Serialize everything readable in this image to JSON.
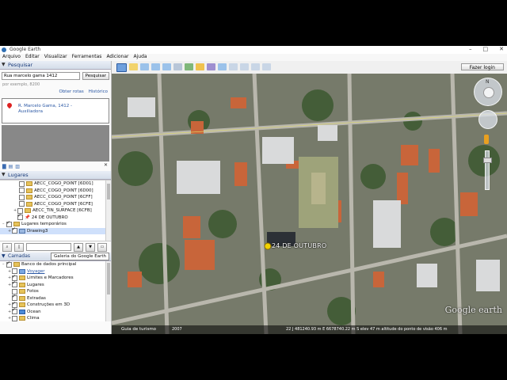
{
  "window": {
    "title": "Google Earth",
    "controls": [
      "–",
      "□",
      "✕"
    ]
  },
  "menu": [
    "Arquivo",
    "Editar",
    "Visualizar",
    "Ferramentas",
    "Adicionar",
    "Ajuda"
  ],
  "search": {
    "header": "Pesquisar",
    "value": "Rua marcelo gama 1412",
    "button": "Pesquisar",
    "hint": "por exemplo, 8200",
    "link_routes": "Obter rotas",
    "link_history": "Histórico",
    "result_line1": "R. Marcelo Gama, 1412 -",
    "result_line2": "Auxiliadora"
  },
  "places": {
    "header": "Lugares",
    "items": [
      {
        "label": "AECC_COGO_POINT [6D01]",
        "checked": false
      },
      {
        "label": "AECC_COGO_POINT [6D00]",
        "checked": false
      },
      {
        "label": "AECC_COGO_POINT [6CFF]",
        "checked": false
      },
      {
        "label": "AECC_COGO_POINT [6CFE]",
        "checked": false
      },
      {
        "label": "AECC_TIN_SURFACE [6CFB]",
        "checked": false
      },
      {
        "label": "24 DE OUTUBRO",
        "checked": true
      },
      {
        "label": "Lugares temporários",
        "checked": true
      },
      {
        "label": "Drawing3",
        "checked": true
      }
    ]
  },
  "layers": {
    "header": "Camadas",
    "gallery_button": "Galeria do Google Earth",
    "items": [
      {
        "label": "Banco de dados principal",
        "checked": true
      },
      {
        "label": "Voyager",
        "checked": false
      },
      {
        "label": "Limites e Marcadores",
        "checked": true
      },
      {
        "label": "Lugares",
        "checked": true
      },
      {
        "label": "Fotos",
        "checked": false
      },
      {
        "label": "Estradas",
        "checked": true
      },
      {
        "label": "Construções em 3D",
        "checked": true
      },
      {
        "label": "Ocean",
        "checked": true
      },
      {
        "label": "Clima",
        "checked": false
      }
    ]
  },
  "toolbar": {
    "login": "Fazer login"
  },
  "map": {
    "placemark": "24 DE OUTUBRO",
    "logo": "Google earth",
    "status_tour": "Guia de turismo",
    "status_year": "2007",
    "status_coords": "22 J 481240.93 m E 6678740.22 m S   elev  47 m   altitude do ponto de visão  406 m"
  }
}
